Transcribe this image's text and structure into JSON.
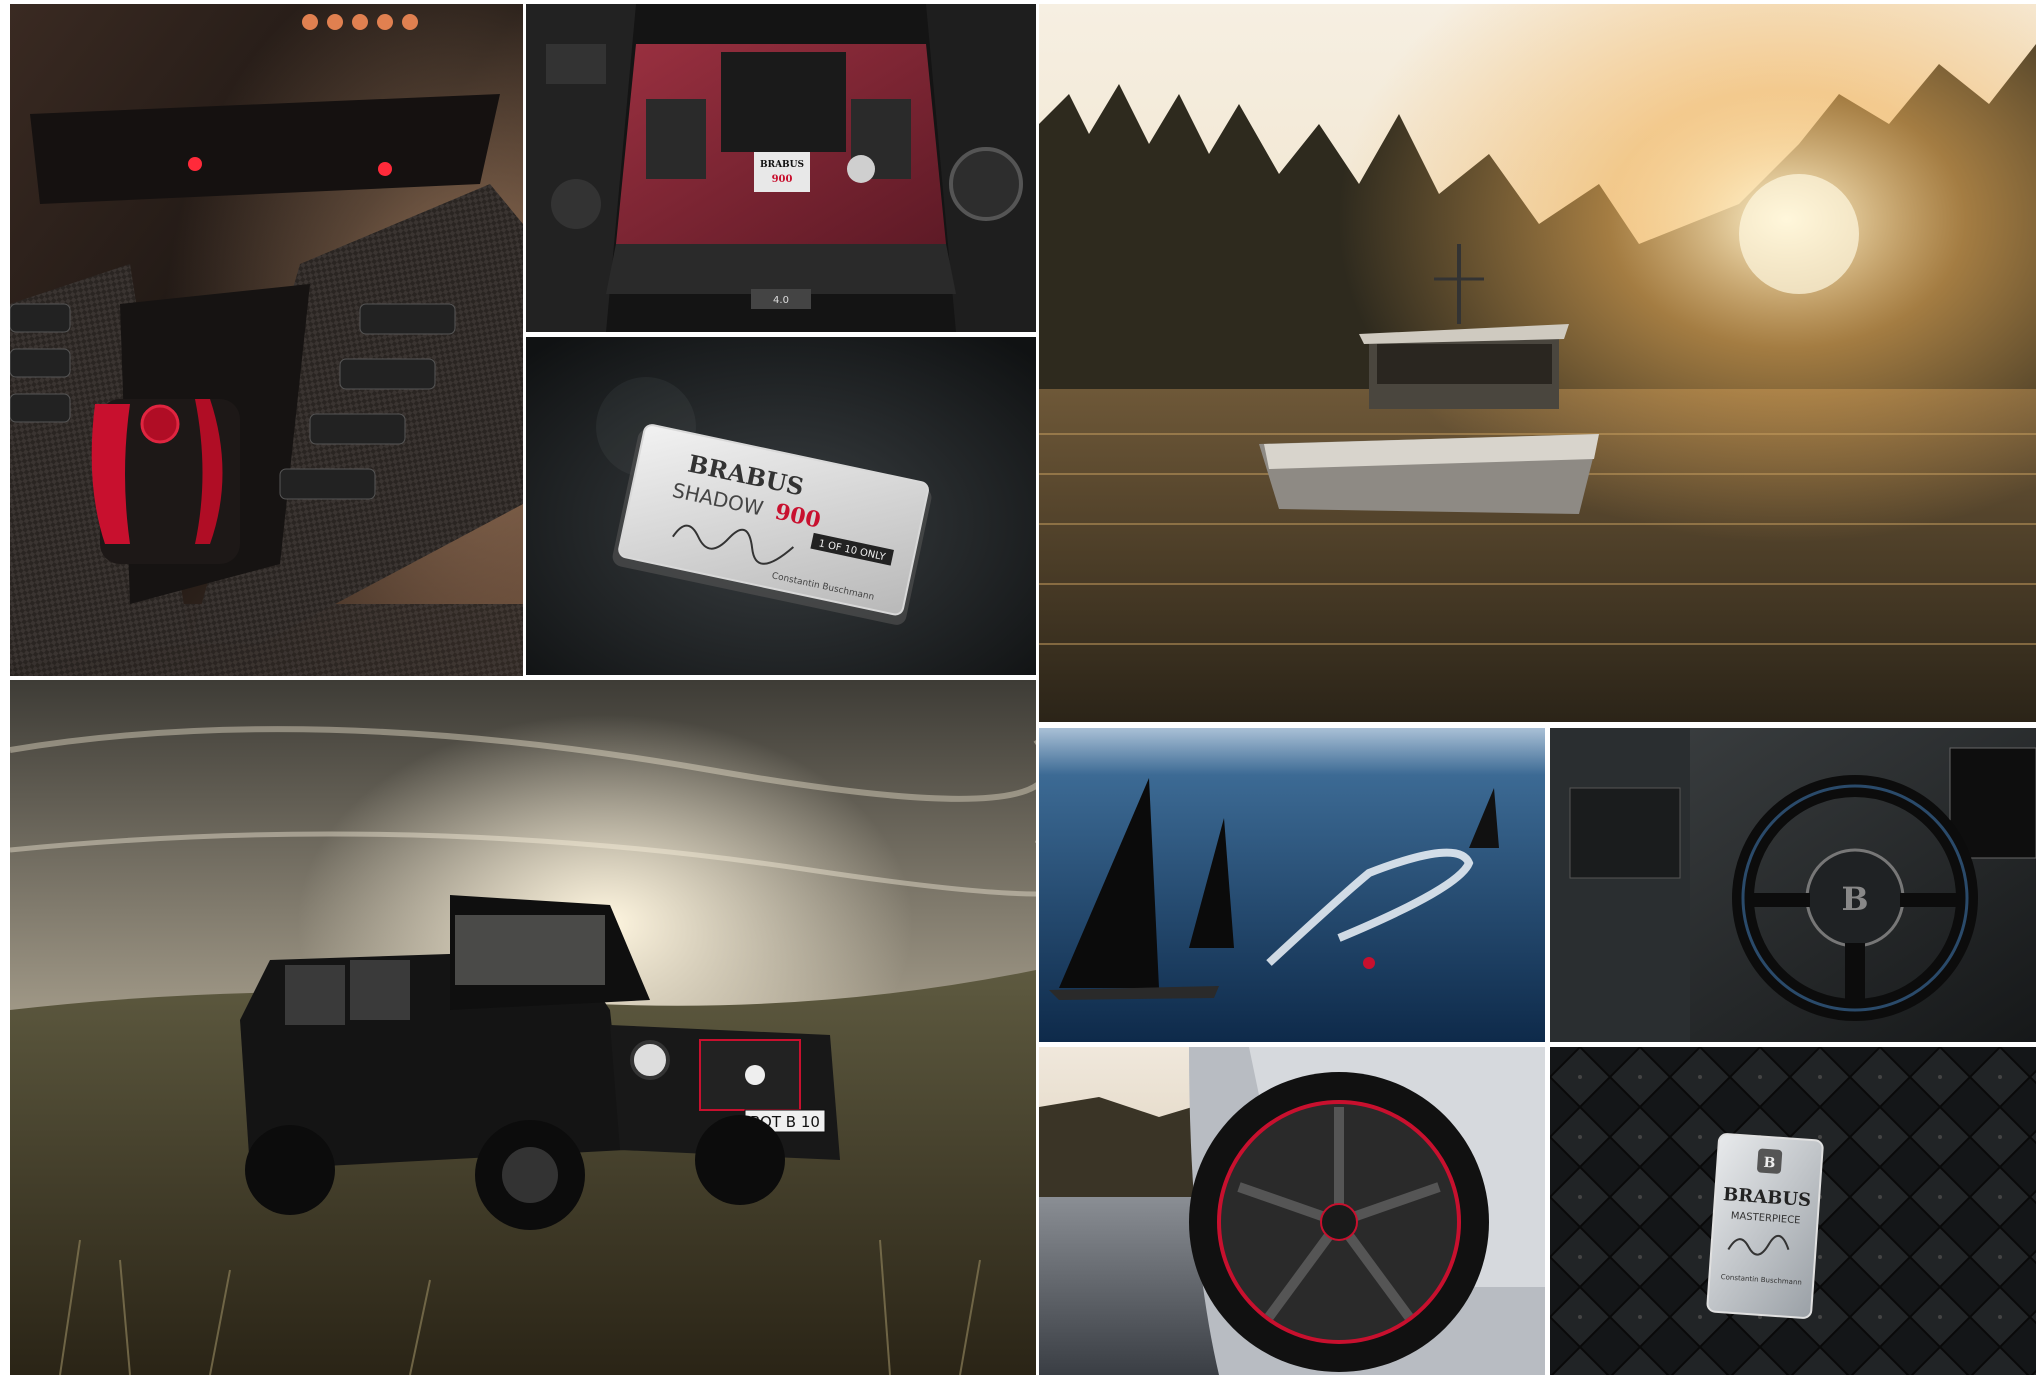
{
  "gallery": {
    "tiles": [
      {
        "id": "interior-console",
        "subject": "carbon fiber center console with red gear selector"
      },
      {
        "id": "engine-bay",
        "subject": "red carbon engine cover",
        "label_brand": "BRABUS",
        "label_model": "900",
        "badge": "4.0"
      },
      {
        "id": "shadow-plaque",
        "subject": "engraved plaque",
        "brand": "BRABUS",
        "model_prefix": "SHADOW",
        "model_number": "900",
        "edition_tag": "1 OF 10 ONLY",
        "signature_name": "Constantin Buschmann"
      },
      {
        "id": "boat-sunset",
        "subject": "motor yacht on lake at sunset"
      },
      {
        "id": "g-wagon-dunes",
        "subject": "black G-class SUV in grassy dunes",
        "plate": "BOT B 10"
      },
      {
        "id": "sailing-yachts",
        "subject": "sailing yachts with speedboat wake on open sea"
      },
      {
        "id": "helm",
        "subject": "yacht steering wheel and helm"
      },
      {
        "id": "wheel-detail",
        "subject": "black alloy wheel with red rim stripe"
      },
      {
        "id": "masterpiece-plaque",
        "subject": "quilted leather with plaque",
        "brand": "BRABUS",
        "subtitle": "MASTERPIECE",
        "signature_name": "Constantin Buschmann"
      }
    ]
  },
  "colors": {
    "accent_red": "#c8102e",
    "sunset_gold": "#f2b35a",
    "sea_blue": "#1b3f66"
  }
}
